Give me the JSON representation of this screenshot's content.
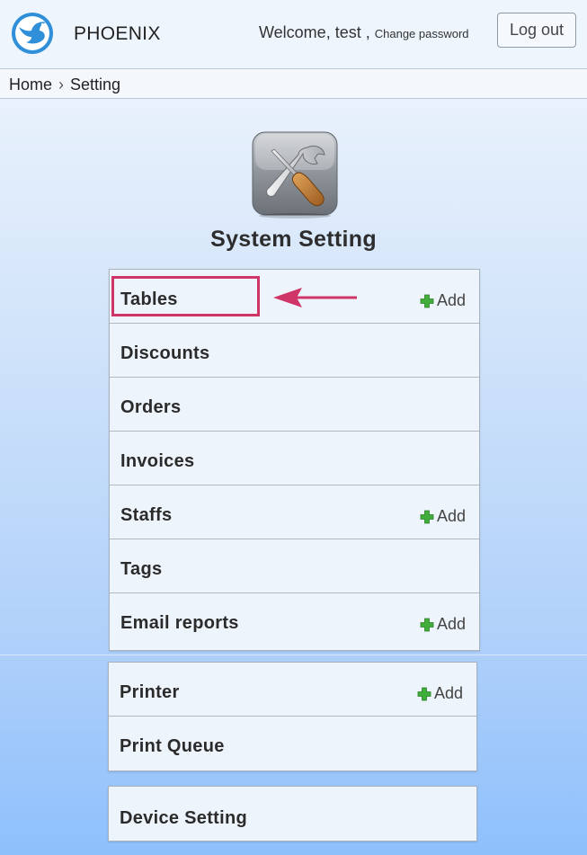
{
  "header": {
    "brand": "PHOENIX",
    "welcome_prefix": "Welcome, test ,",
    "change_password": "Change password",
    "logout": "Log out"
  },
  "breadcrumb": {
    "home": "Home",
    "separator": "›",
    "current": "Setting"
  },
  "page_title": "System Setting",
  "groups": [
    [
      {
        "label": "Tables",
        "add": "Add"
      },
      {
        "label": "Discounts"
      },
      {
        "label": "Orders"
      },
      {
        "label": "Invoices"
      },
      {
        "label": "Staffs",
        "add": "Add"
      },
      {
        "label": "Tags"
      },
      {
        "label": "Email reports",
        "add": "Add"
      }
    ],
    [
      {
        "label": "Printer",
        "add": "Add"
      },
      {
        "label": "Print Queue"
      }
    ],
    [
      {
        "label": "Device Setting"
      }
    ]
  ],
  "icons": {
    "logo": "phoenix-bird-icon",
    "settings": "wrench-screwdriver-icon",
    "add": "green-plus-icon",
    "pointer": "left-arrow-icon"
  },
  "colors": {
    "highlight": "#cf3567",
    "add_plus": "#3fae3a",
    "logo_blue": "#2f8fd9"
  }
}
